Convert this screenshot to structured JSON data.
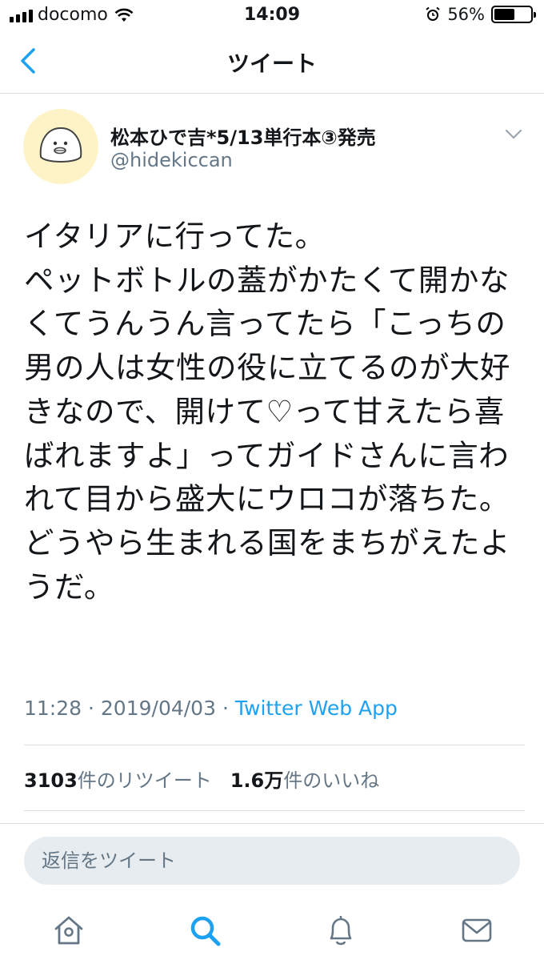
{
  "status_bar": {
    "carrier": "docomo",
    "time": "14:09",
    "battery_percent": "56%",
    "battery_level": 0.56
  },
  "nav": {
    "title": "ツイート"
  },
  "tweet": {
    "author_name": "松本ひで吉*5/13単行本③発売",
    "handle": "@hidekiccan",
    "text": "イタリアに行ってた。\nペットボトルの蓋がかたくて開かなくてうんうん言ってたら「こっちの男の人は女性の役に立てるのが大好きなので、開けて♡って甘えたら喜ばれますよ」ってガイドさんに言われて目から盛大にウロコが落ちた。\nどうやら生まれる国をまちがえたようだ。",
    "time": "11:28",
    "date": "2019/04/03",
    "separator": "·",
    "via": "Twitter Web App",
    "retweet_count": "3103",
    "retweet_label": "件のリツイート",
    "like_count": "1.6万",
    "like_label": "件のいいね"
  },
  "reply": {
    "placeholder": "返信をツイート"
  },
  "icons": {
    "back": "chevron-left-icon",
    "caret": "chevron-down-icon",
    "tabs": [
      "home-icon",
      "search-icon",
      "notifications-icon",
      "messages-icon"
    ]
  },
  "colors": {
    "accent": "#1da1f2",
    "secondary_text": "#657786",
    "divider": "#d8dee2",
    "reply_bg": "#e6ecf0"
  }
}
